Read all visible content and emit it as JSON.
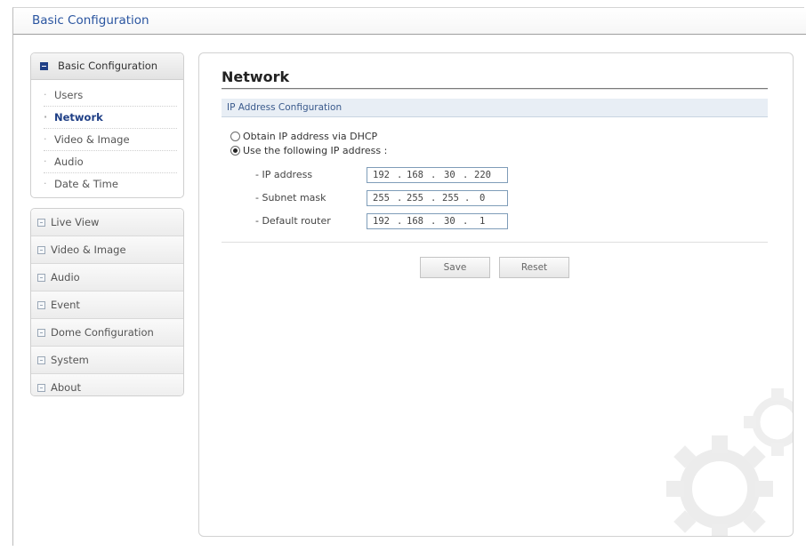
{
  "header": {
    "title": "Basic Configuration"
  },
  "sidebar": {
    "config_group": {
      "label": "Basic Configuration",
      "items": [
        {
          "label": "Users",
          "active": false
        },
        {
          "label": "Network",
          "active": true
        },
        {
          "label": "Video & Image",
          "active": false
        },
        {
          "label": "Audio",
          "active": false
        },
        {
          "label": "Date & Time",
          "active": false
        }
      ]
    },
    "menu": [
      {
        "label": "Live View"
      },
      {
        "label": "Video & Image"
      },
      {
        "label": "Audio"
      },
      {
        "label": "Event"
      },
      {
        "label": "Dome Configuration"
      },
      {
        "label": "System"
      },
      {
        "label": "About"
      }
    ]
  },
  "main": {
    "title": "Network",
    "section": "IP Address Configuration",
    "options": {
      "dhcp_label": "Obtain IP address via DHCP",
      "static_label": "Use the following IP address :",
      "selected": "static"
    },
    "fields": {
      "ip": {
        "label": "- IP address",
        "octets": [
          "192",
          "168",
          "30",
          "220"
        ]
      },
      "subnet": {
        "label": "- Subnet mask",
        "octets": [
          "255",
          "255",
          "255",
          "0"
        ]
      },
      "router": {
        "label": "- Default router",
        "octets": [
          "192",
          "168",
          "30",
          "1"
        ]
      }
    },
    "buttons": {
      "save": "Save",
      "reset": "Reset"
    }
  },
  "colors": {
    "accent": "#1f3f86",
    "link": "#2a55a0",
    "section_bg": "#e8eef5"
  },
  "icons": {
    "expanded": "minus-square-icon",
    "collapsed": "plus-square-icon",
    "watermark": "gears-watermark-icon"
  }
}
